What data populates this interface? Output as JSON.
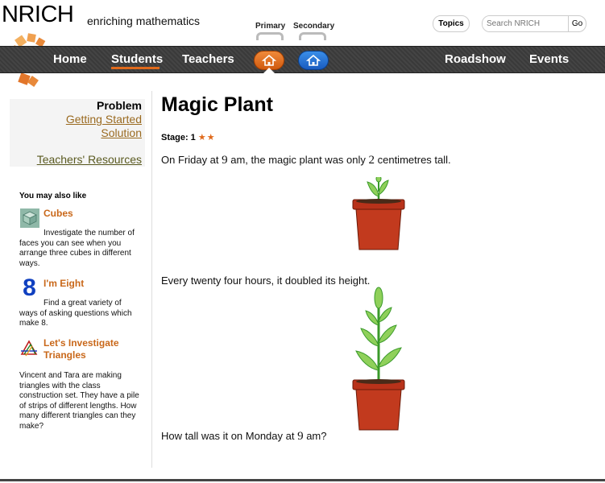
{
  "header": {
    "brand": "NRICH",
    "tagline": "enriching mathematics",
    "tabs": [
      {
        "label": "Primary"
      },
      {
        "label": "Secondary"
      }
    ],
    "topics_label": "Topics",
    "search_placeholder": "Search NRICH",
    "search_go": "Go"
  },
  "nav": {
    "items": [
      "Home",
      "Students",
      "Teachers",
      "Roadshow",
      "Events"
    ],
    "active": "Students",
    "accent": "#e06a1c"
  },
  "sidebar": {
    "problem_label": "Problem",
    "getting_started": "Getting Started",
    "solution": "Solution",
    "teachers_resources": "Teachers' Resources",
    "also_like_heading": "You may also like",
    "related": [
      {
        "title": "Cubes",
        "icon": "cubes-icon",
        "description": "Investigate the number of faces you can see when you arrange three cubes in different ways."
      },
      {
        "title": "I'm Eight",
        "icon": "eight-icon",
        "glyph": "8",
        "description": "Find a great variety of ways of asking questions which make 8."
      },
      {
        "title": "Let's Investigate Triangles",
        "icon": "triangles-icon",
        "description": "Vincent and Tara are making triangles with the class construction set. They have a pile of strips of different lengths. How many different triangles can they make?"
      }
    ]
  },
  "main": {
    "title": "Magic Plant",
    "stage_label": "Stage: 1",
    "stars": "★★",
    "p1_a": "On Friday at ",
    "p1_n1": "9",
    "p1_b": " am, the magic plant was only ",
    "p1_n2": "2",
    "p1_c": " centimetres tall.",
    "p2": "Every twenty four hours, it doubled its height.",
    "p3_a": "How tall was it on Monday at ",
    "p3_n1": "9",
    "p3_b": " am?"
  }
}
